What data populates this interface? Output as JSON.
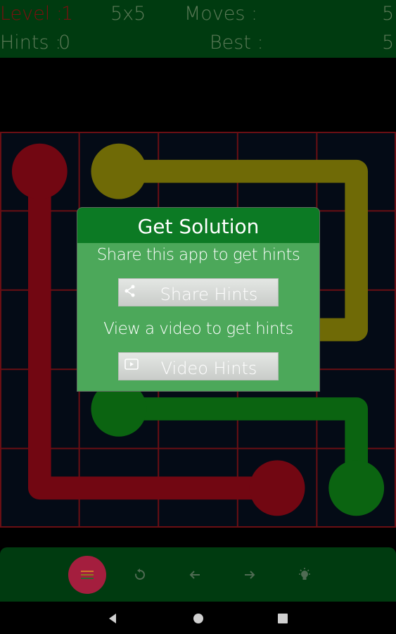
{
  "header": {
    "level_label": "Level :",
    "level_value": "1",
    "grid_size": "5x5",
    "moves_label": "Moves :",
    "moves_value": "5",
    "hints_label": "Hints :",
    "hints_value": "0",
    "best_label": "Best :",
    "best_value": "5"
  },
  "board": {
    "rows": 5,
    "cols": 5,
    "flows": [
      {
        "color": "#720712",
        "path": [
          [
            0,
            0
          ],
          [
            0,
            4
          ],
          [
            3,
            4
          ]
        ],
        "endpoints": [
          [
            0,
            0
          ],
          [
            3,
            4
          ]
        ]
      },
      {
        "color": "#6f6a06",
        "path": [
          [
            1,
            0
          ],
          [
            4,
            0
          ],
          [
            4,
            2
          ],
          [
            3,
            2
          ]
        ],
        "endpoints": [
          [
            1,
            0
          ]
        ]
      },
      {
        "color": "#0b6411",
        "path": [
          [
            1,
            3
          ],
          [
            4,
            3
          ],
          [
            4,
            4
          ]
        ],
        "endpoints": [
          [
            1,
            3
          ],
          [
            4,
            4
          ]
        ]
      }
    ],
    "grid_color": "#6a0f14"
  },
  "dialog": {
    "title": "Get Solution",
    "share_text": "Share this app to get hints",
    "share_button": "Share Hints",
    "share_icon": "share-icon",
    "video_text": "View a video to get hints",
    "video_button": "Video Hints",
    "video_icon": "video-icon"
  },
  "toolbar": {
    "items": [
      "menu-icon",
      "restart-icon",
      "arrow-left-icon",
      "arrow-right-icon",
      "bulb-icon"
    ]
  },
  "navbar": {
    "items": [
      "back-icon",
      "home-icon",
      "recents-icon"
    ]
  }
}
